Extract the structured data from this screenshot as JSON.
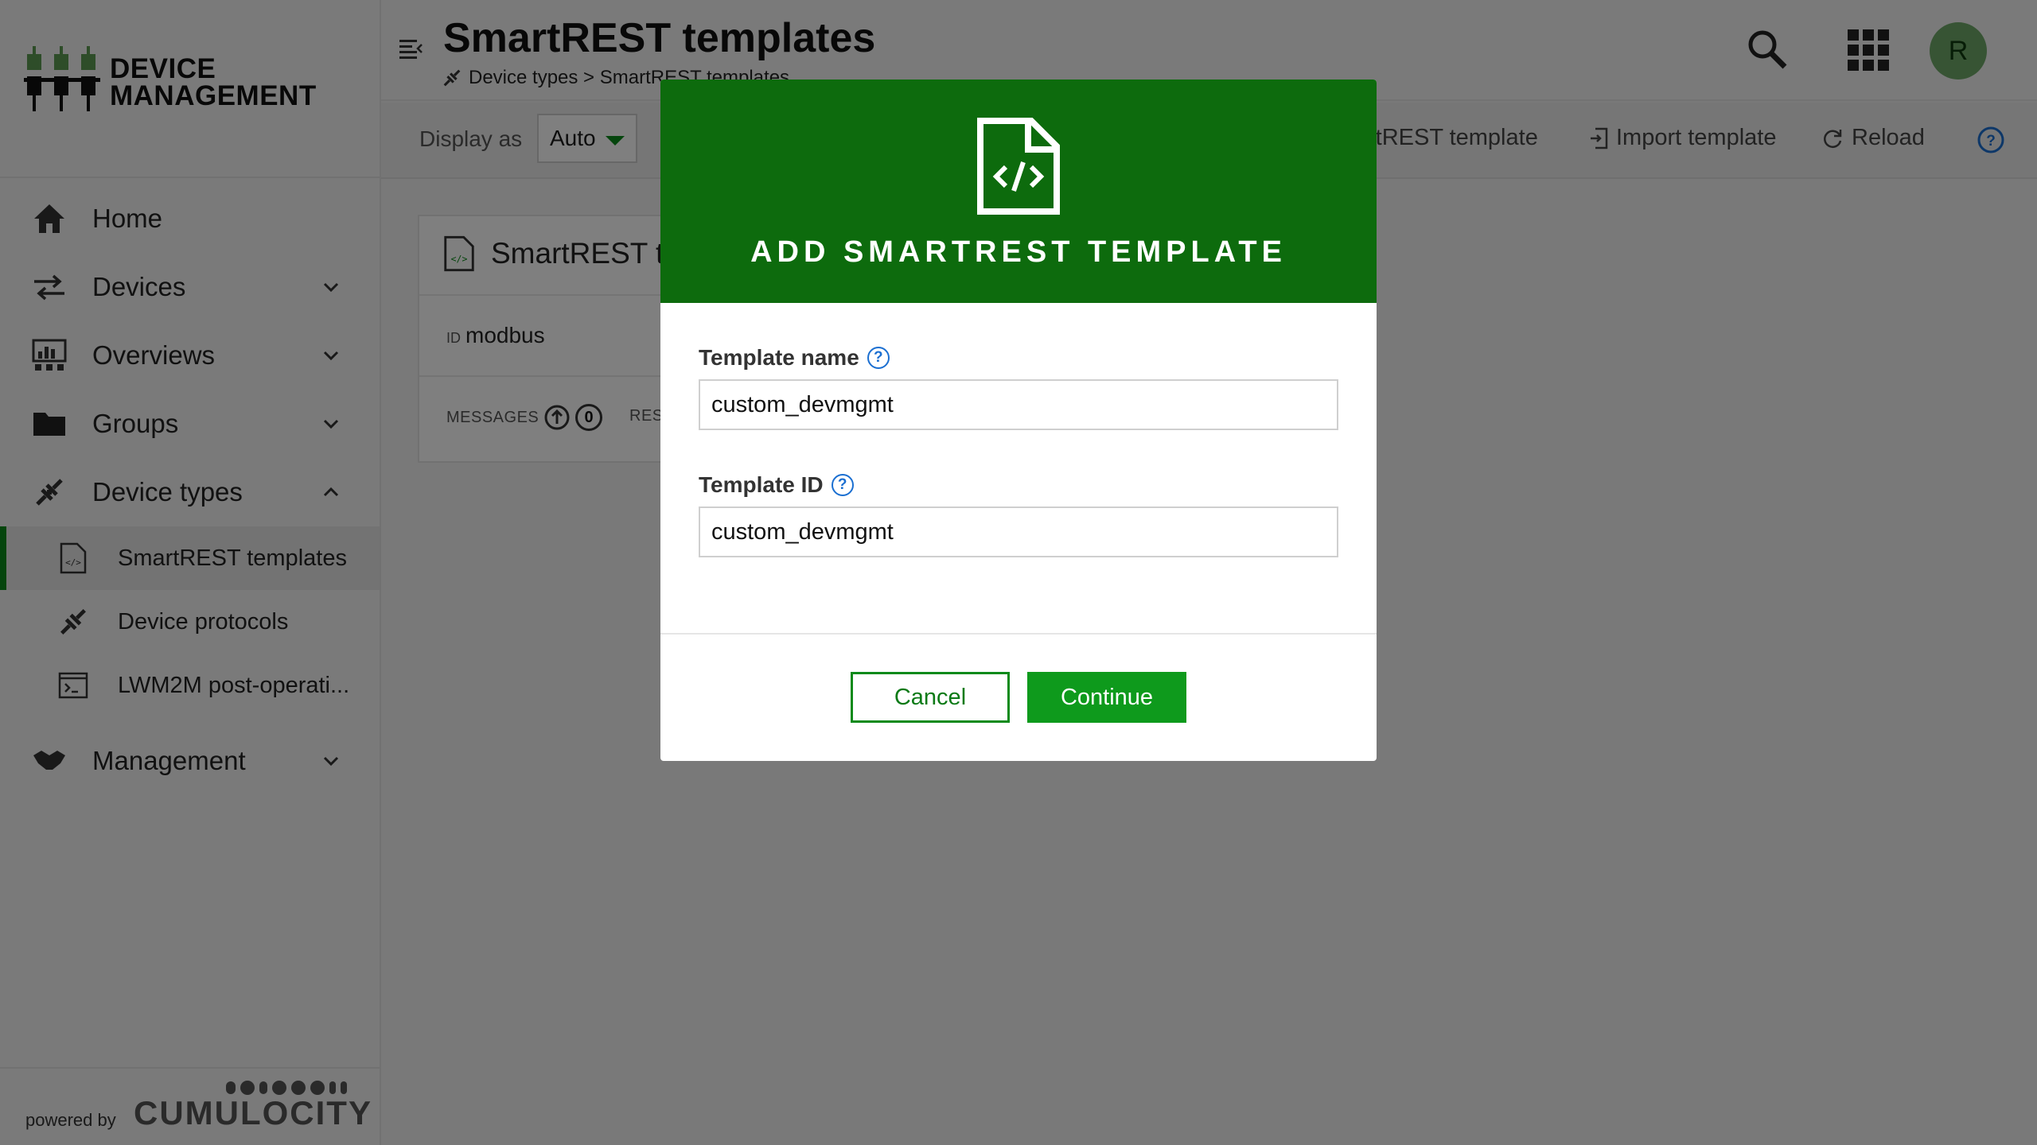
{
  "brand": {
    "line1": "DEVICE",
    "line2": "MANAGEMENT"
  },
  "nav": {
    "home": "Home",
    "devices": "Devices",
    "overviews": "Overviews",
    "groups": "Groups",
    "device_types": "Device types",
    "smartrest_templates": "SmartREST templates",
    "device_protocols": "Device protocols",
    "lwm2m": "LWM2M post-operati...",
    "management": "Management"
  },
  "footer": {
    "powered_by": "powered by",
    "brand": "CUMULOCITY"
  },
  "header": {
    "title": "SmartREST templates",
    "breadcrumb": "Device types > SmartREST templates",
    "avatar_initial": "R"
  },
  "actionbar": {
    "display_as_label": "Display as",
    "display_as_value": "Auto",
    "add_label": "rtREST template",
    "import_label": "Import template",
    "reload_label": "Reload"
  },
  "card": {
    "title": "SmartREST t",
    "id_label": "ID",
    "id_value": "modbus",
    "messages_label": "MESSAGES",
    "messages_count": "0",
    "responses_label": "RES"
  },
  "modal": {
    "title": "ADD SMARTREST TEMPLATE",
    "template_name_label": "Template name",
    "template_name_value": "custom_devmgmt",
    "template_id_label": "Template ID",
    "template_id_value": "custom_devmgmt",
    "help_glyph": "?",
    "cancel_label": "Cancel",
    "continue_label": "Continue"
  },
  "colors": {
    "brand_green": "#0d6b0d",
    "accent_green": "#0e9a1c",
    "help_blue": "#1b6fd1",
    "avatar_bg": "#6ea868"
  },
  "icons": [
    "home-icon",
    "devices-icon",
    "overviews-icon",
    "groups-icon",
    "device-types-icon",
    "template-icon",
    "protocol-icon",
    "terminal-icon",
    "management-icon",
    "search-icon",
    "apps-grid-icon",
    "help-icon",
    "reload-icon",
    "import-icon",
    "code-file-icon"
  ]
}
